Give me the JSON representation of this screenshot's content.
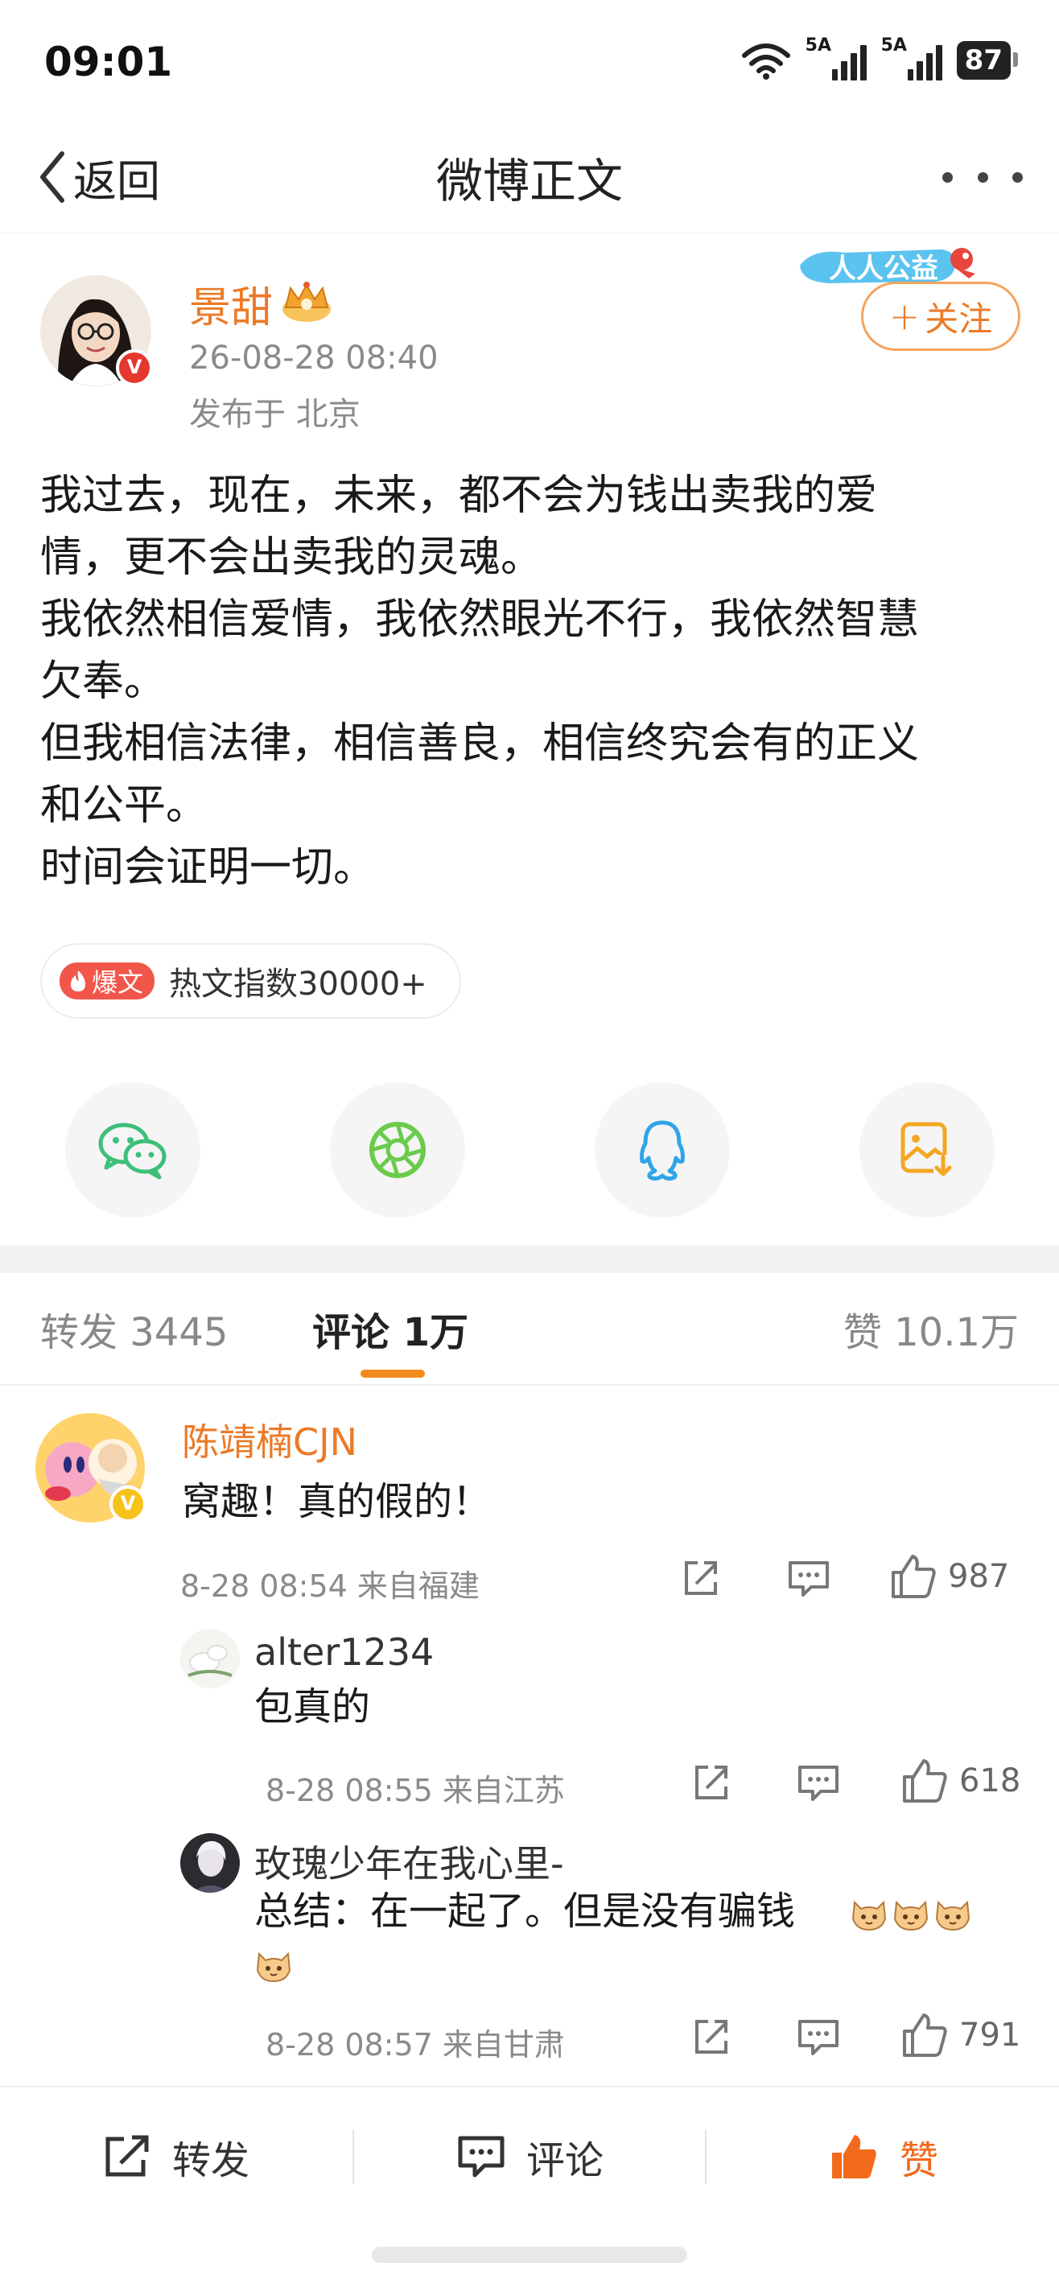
{
  "status_bar": {
    "time": "09:01",
    "signal1_label": "5A",
    "signal2_label": "5A",
    "battery": "87"
  },
  "nav": {
    "back_label": "返回",
    "title": "微博正文"
  },
  "post": {
    "author": "景甜",
    "time": "26-08-28 08:40",
    "location": "发布于 北京",
    "charity_badge": "人人公益",
    "follow_label": "关注",
    "content": "我过去，现在，未来，都不会为钱出卖我的爱\n情，更不会出卖我的灵魂。\n我依然相信爱情，我依然眼光不行，我依然智慧\n欠奉。\n但我相信法律，相信善良，相信终究会有的正义\n和公平。\n时间会证明一切。",
    "hot_tag": "爆文",
    "hot_text": "热文指数30000+"
  },
  "share_buttons": [
    "wechat-icon",
    "moments-icon",
    "qq-icon",
    "save-image-icon"
  ],
  "tabs": {
    "repost": "转发 3445",
    "comments": "评论 1万",
    "likes": "赞 10.1万"
  },
  "comments": [
    {
      "name": "陈靖楠CJN",
      "text": "窝趣！真的假的！",
      "meta": "8-28 08:54 来自福建",
      "likes": "987"
    },
    {
      "name": "alter1234",
      "text": "包真的",
      "meta": "8-28 08:55 来自江苏",
      "likes": "618"
    },
    {
      "name": "玫瑰少年在我心里-",
      "text": "总结：在一起了。但是没有骗钱",
      "meta": "8-28 08:57 来自甘肃",
      "likes": "791"
    }
  ],
  "bottom_bar": {
    "repost": "转发",
    "comment": "评论",
    "like": "赞"
  },
  "colors": {
    "accent_orange": "#eb7a27",
    "like_orange": "#f26a1b",
    "underline": "#f28a1e",
    "hot_red": "#f2564a"
  }
}
